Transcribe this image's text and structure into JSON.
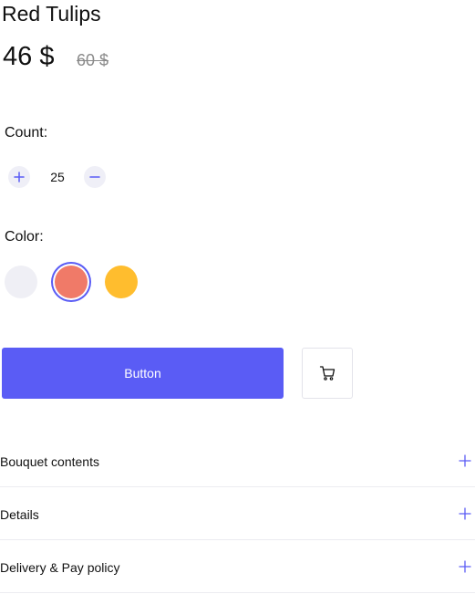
{
  "product": {
    "title": "Red Tulips",
    "price": "46 $",
    "old_price": "60 $"
  },
  "count": {
    "label": "Count:",
    "value": "25"
  },
  "color": {
    "label": "Color:",
    "options": [
      {
        "name": "light-gray",
        "hex": "#efeff5",
        "selected": false
      },
      {
        "name": "coral",
        "hex": "#f07a68",
        "selected": true
      },
      {
        "name": "yellow",
        "hex": "#ffbd2e",
        "selected": false
      }
    ]
  },
  "actions": {
    "primary_label": "Button",
    "primary_color": "#5a5cf5",
    "cart_icon": "cart-icon"
  },
  "accordion": [
    {
      "label": "Bouquet contents",
      "icon": "plus-icon"
    },
    {
      "label": "Details",
      "icon": "plus-icon"
    },
    {
      "label": "Delivery & Pay policy",
      "icon": "plus-icon"
    }
  ],
  "theme": {
    "accent": "#5a5cf5",
    "stepper_bg": "#efeff7",
    "divider": "#ececf1"
  }
}
